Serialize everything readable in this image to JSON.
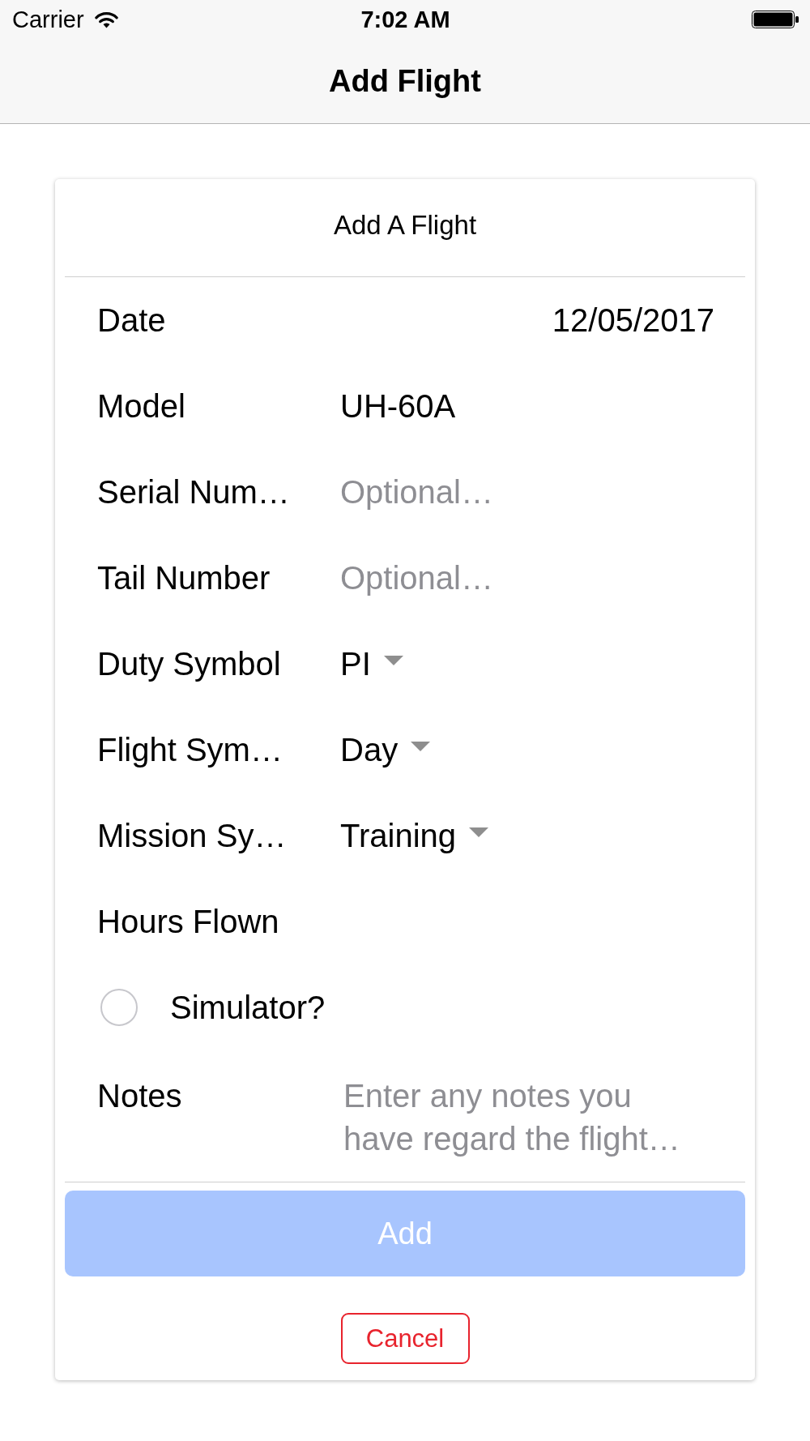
{
  "status_bar": {
    "carrier": "Carrier",
    "time": "7:02 AM"
  },
  "nav_bar": {
    "title": "Add Flight"
  },
  "form": {
    "title": "Add A Flight",
    "rows": [
      {
        "kind": "date",
        "label": "Date",
        "value": "12/05/2017"
      },
      {
        "kind": "text",
        "label": "Model",
        "value": "UH-60A"
      },
      {
        "kind": "text",
        "label": "Serial Num…",
        "placeholder": "Optional…"
      },
      {
        "kind": "text",
        "label": "Tail Number",
        "placeholder": "Optional…"
      },
      {
        "kind": "dropdown",
        "label": "Duty Symbol",
        "value": "PI"
      },
      {
        "kind": "dropdown",
        "label": "Flight Sym…",
        "value": "Day"
      },
      {
        "kind": "dropdown",
        "label": "Mission Sy…",
        "value": "Training"
      },
      {
        "kind": "text",
        "label": "Hours Flown"
      },
      {
        "kind": "radio",
        "label": "Simulator?",
        "checked": false
      },
      {
        "kind": "textarea",
        "label": "Notes",
        "placeholder": "Enter any notes you have regard the flight…"
      }
    ],
    "buttons": [
      {
        "kind": "primary",
        "label": "Add",
        "disabled": true
      },
      {
        "kind": "outline",
        "label": "Cancel",
        "disabled": false
      }
    ]
  }
}
